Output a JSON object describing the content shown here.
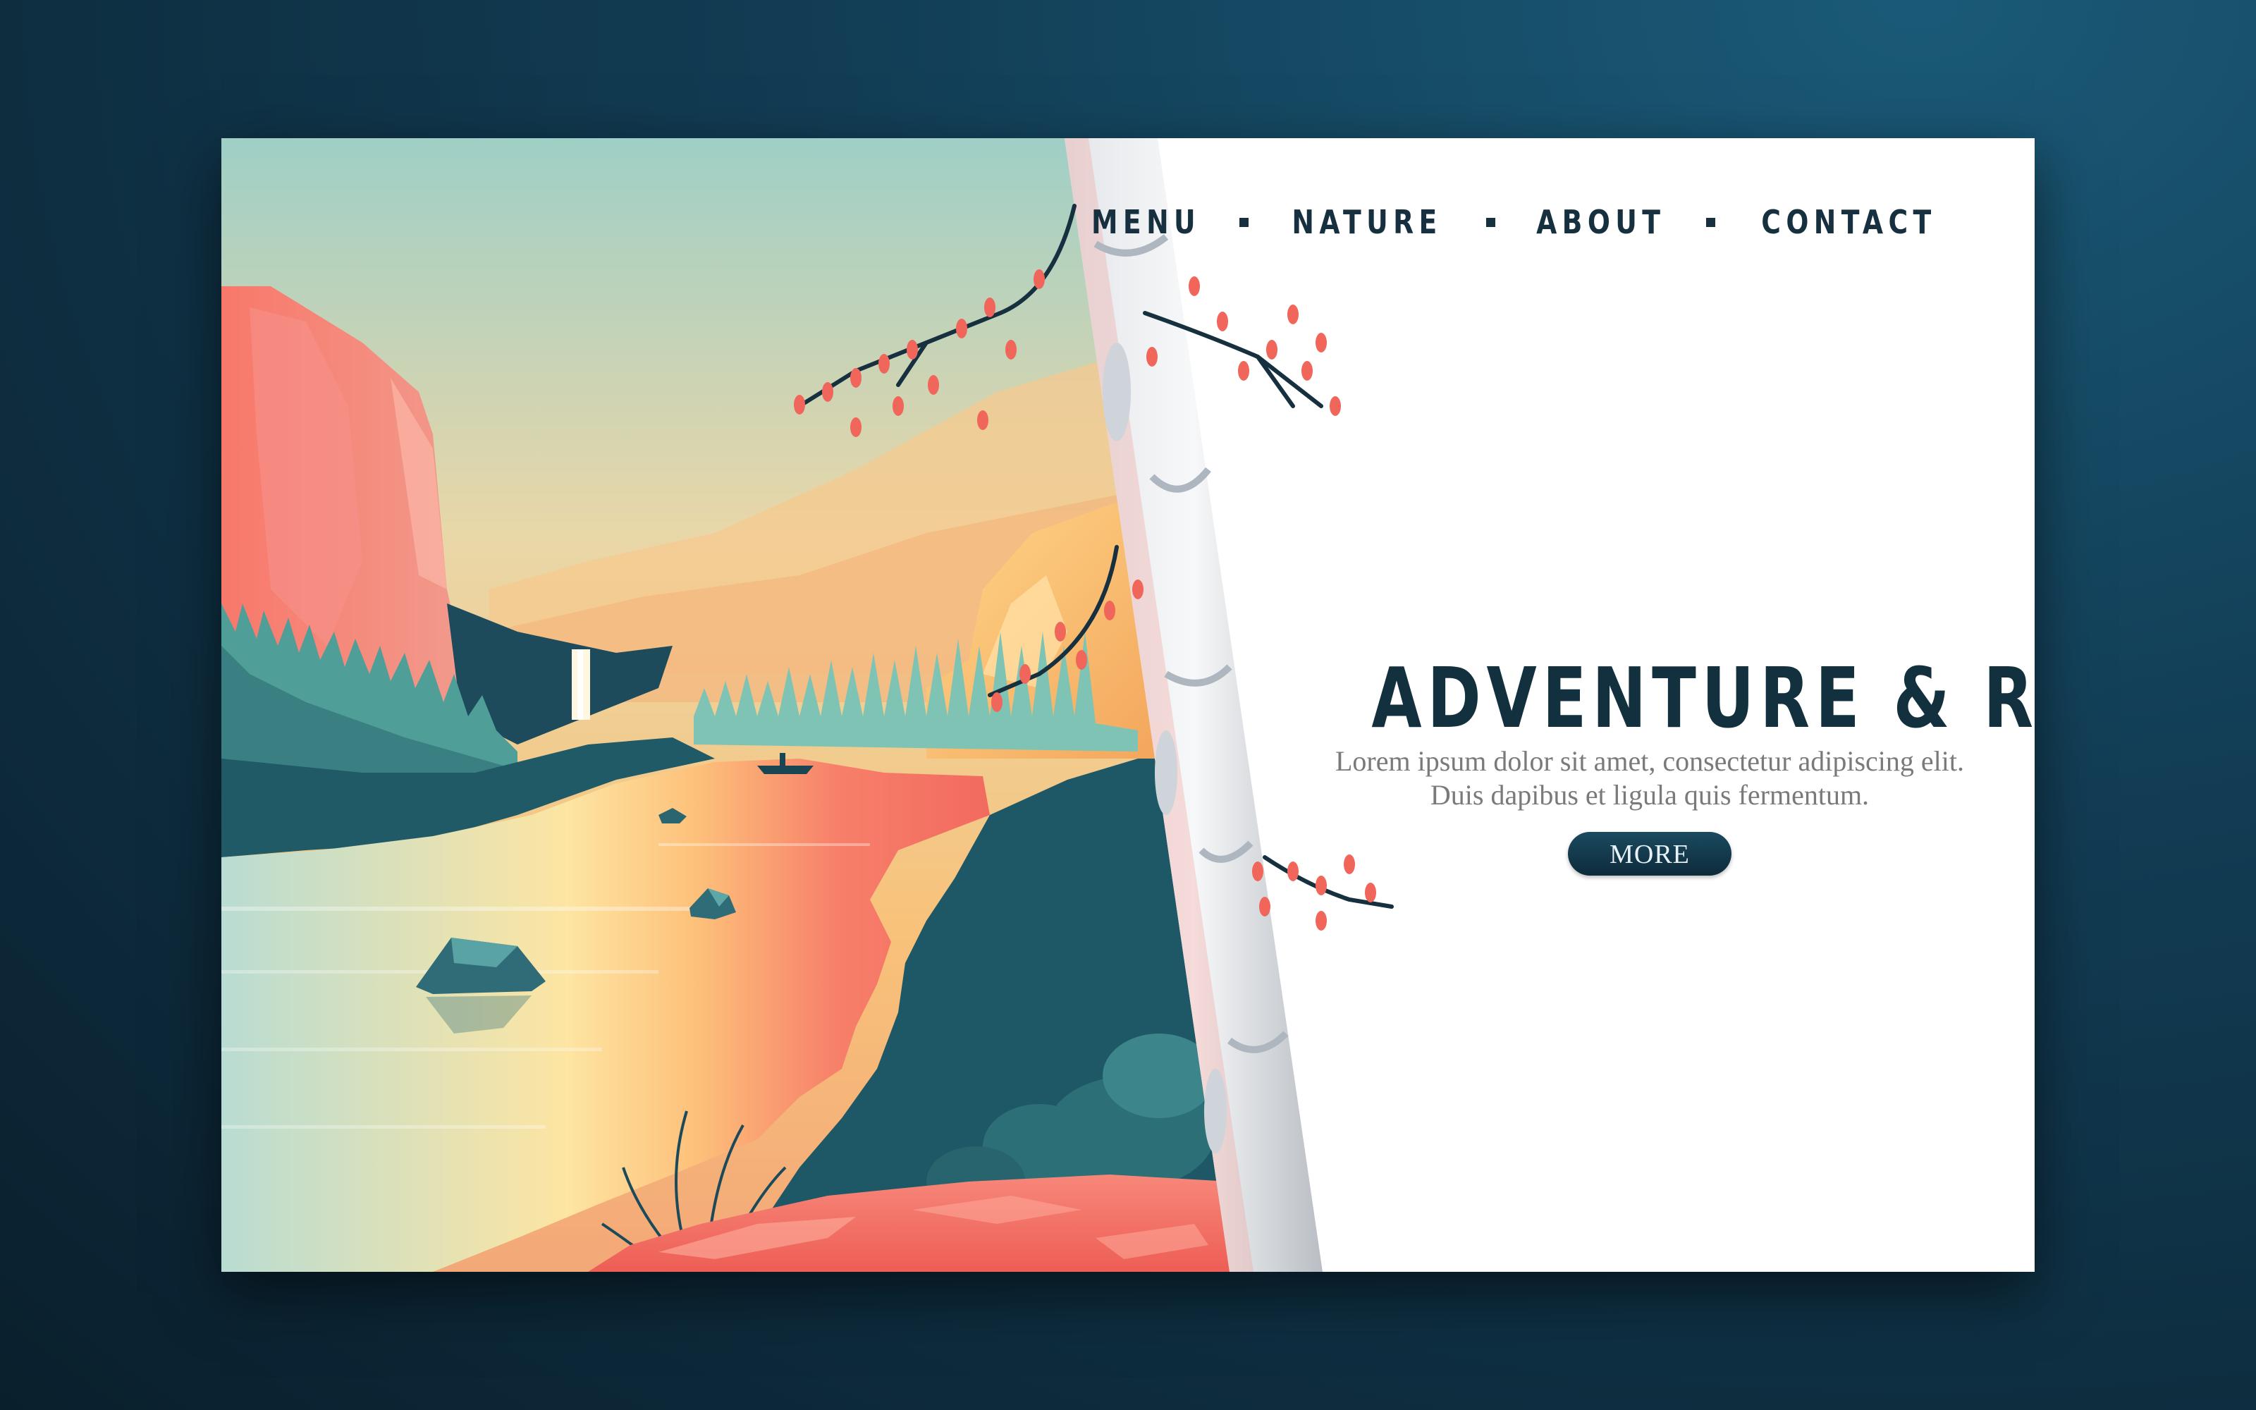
{
  "nav": {
    "items": [
      {
        "label": "MENU"
      },
      {
        "label": "NATURE"
      },
      {
        "label": "ABOUT"
      },
      {
        "label": "CONTACT"
      }
    ]
  },
  "hero": {
    "title": "ADVENTURE & RIVER",
    "subtitle_line1": "Lorem ipsum dolor sit amet, consectetur adipiscing elit.",
    "subtitle_line2": "Duis dapibus et ligula quis fermentum.",
    "button_label": "MORE"
  },
  "colors": {
    "page_background": "#123d55",
    "card_background": "#ffffff",
    "text_dark": "#12303e",
    "accent_coral": "#f0665a",
    "water_teal": "#1f5560",
    "button_background": "#12384b"
  }
}
